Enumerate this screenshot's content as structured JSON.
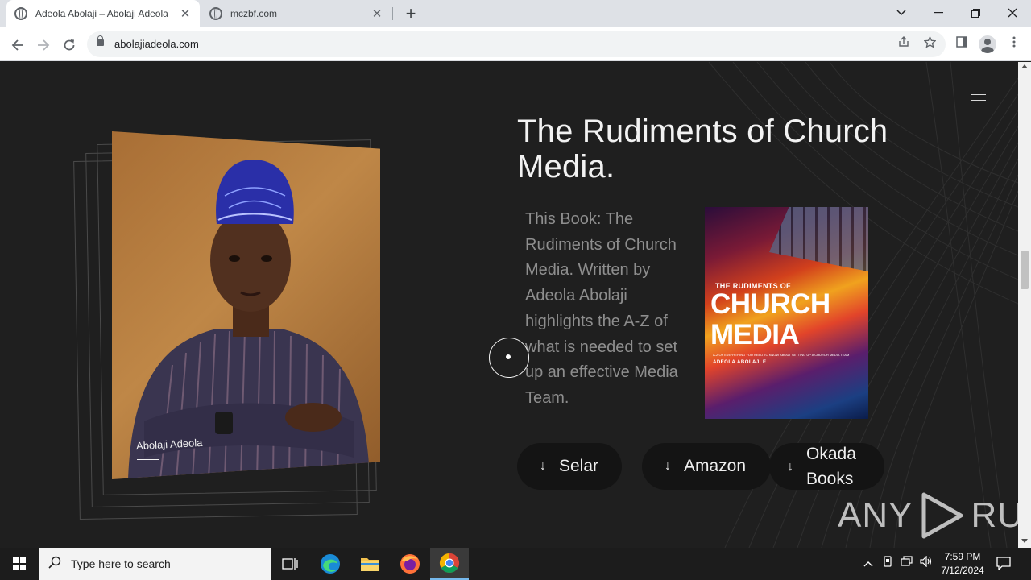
{
  "browser": {
    "tabs": [
      {
        "title": "Adeola Abolaji – Abolaji Adeola",
        "active": true
      },
      {
        "title": "mczbf.com",
        "active": false
      }
    ],
    "url": "abolajiadeola.com"
  },
  "page": {
    "portrait_caption": "Abolaji Adeola",
    "book_title": "The Rudiments of Church Media.",
    "description": "This Book: The Rudiments of Church Media. Written by Adeola Abolaji highlights the A-Z of what is needed to set up an effective Media Team.",
    "cover": {
      "small": "THE RUDIMENTS OF",
      "big1": "CHURCH",
      "big2": "MEDIA",
      "tagline": "A-Z OF EVERYTHING YOU NEED TO KNOW ABOUT SETTING UP A CHURCH MEDIA TEAM",
      "author": "ADEOLA ABOLAJI E."
    },
    "buttons": {
      "selar": "Selar",
      "amazon": "Amazon",
      "okada_line1": "Okada",
      "okada_line2": "Books"
    },
    "watermark_left": "ANY",
    "watermark_right": "RUN"
  },
  "taskbar": {
    "search_placeholder": "Type here to search",
    "time": "7:59 PM",
    "date": "7/12/2024"
  },
  "icons": {
    "arrow_down": "↓",
    "accent": "#76b9ed"
  }
}
